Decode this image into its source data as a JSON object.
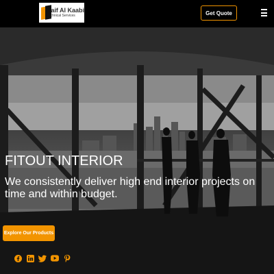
{
  "header": {
    "logo": {
      "name": "Saif Al Kaabi",
      "subtitle": "Technical Services"
    },
    "quote_label": "Get Quote",
    "menu_icon": "hamburger-menu-icon"
  },
  "hero": {
    "title": "FITOUT INTERIOR",
    "tagline": "We consistently deliver high end interior projects on time and within budget.",
    "cta_label": "Explore Our Products"
  },
  "social": [
    "facebook-icon",
    "linkedin-icon",
    "twitter-icon",
    "youtube-icon",
    "pinterest-icon"
  ],
  "colors": {
    "accent": "#f29400",
    "header_bg": "#000000",
    "text": "#ffffff"
  }
}
